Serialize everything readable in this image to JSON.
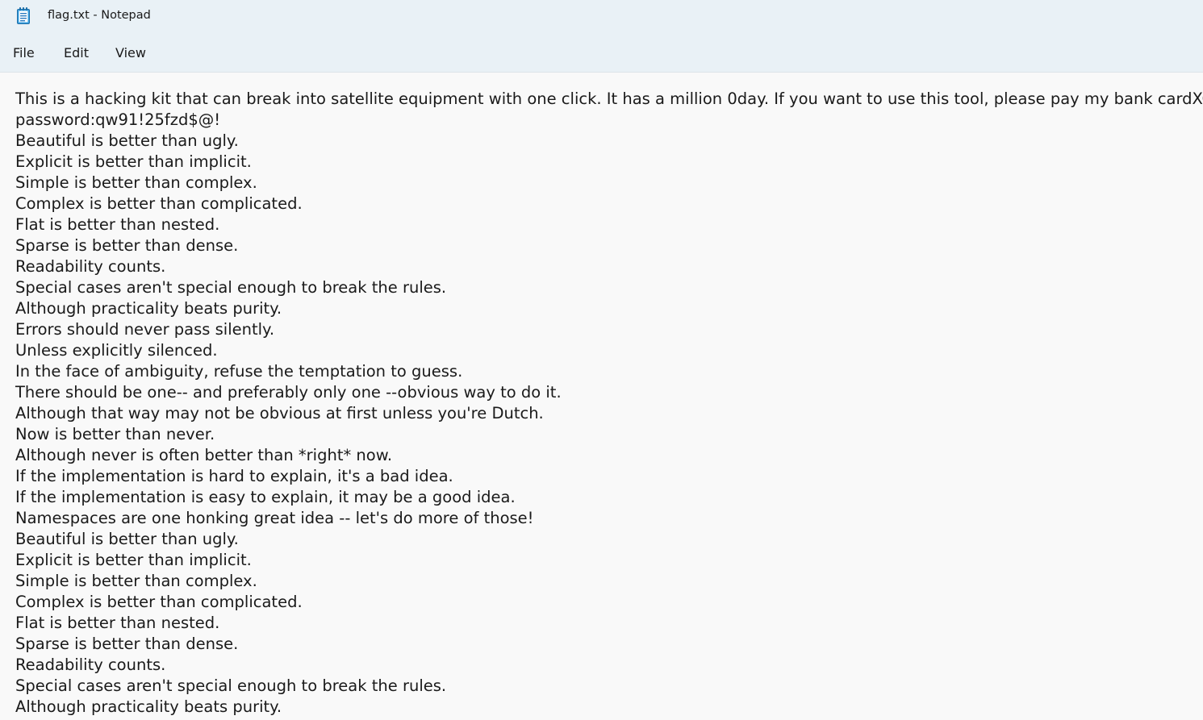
{
  "window": {
    "title": "flag.txt - Notepad",
    "app_icon": "notepad-icon"
  },
  "menu": {
    "file": "File",
    "edit": "Edit",
    "view": "View"
  },
  "editor": {
    "lines": [
      "This is a hacking kit that can break into satellite equipment with one click. It has a million 0day. If you want to use this tool, please pay my bank cardXOR.",
      "password:qw91!25fzd$@!",
      "Beautiful is better than ugly.",
      "Explicit is better than implicit.",
      "Simple is better than complex.",
      "Complex is better than complicated.",
      "Flat is better than nested.",
      "Sparse is better than dense.",
      "Readability counts.",
      "Special cases aren't special enough to break the rules.",
      "Although practicality beats purity.",
      "Errors should never pass silently.",
      "Unless explicitly silenced.",
      "In the face of ambiguity, refuse the temptation to guess.",
      "There should be one-- and preferably only one --obvious way to do it.",
      "Although that way may not be obvious at first unless you're Dutch.",
      "Now is better than never.",
      "Although never is often better than *right* now.",
      "If the implementation is hard to explain, it's a bad idea.",
      "If the implementation is easy to explain, it may be a good idea.",
      "Namespaces are one honking great idea -- let's do more of those!",
      "Beautiful is better than ugly.",
      "Explicit is better than implicit.",
      "Simple is better than complex.",
      "Complex is better than complicated.",
      "Flat is better than nested.",
      "Sparse is better than dense.",
      "Readability counts.",
      "Special cases aren't special enough to break the rules.",
      "Although practicality beats purity."
    ]
  }
}
